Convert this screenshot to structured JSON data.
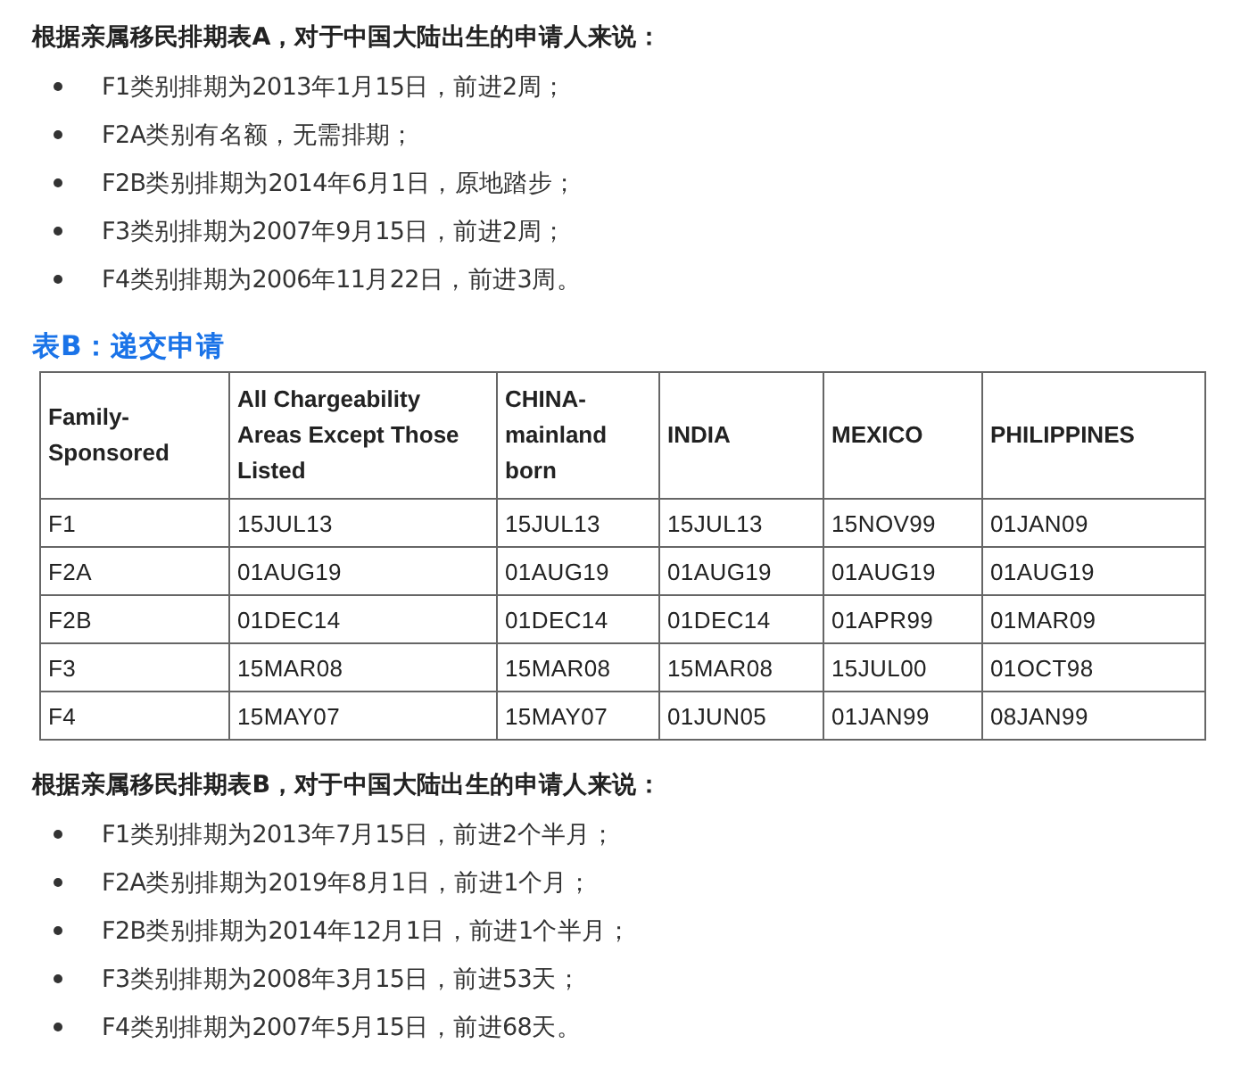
{
  "section_a": {
    "heading": "根据亲属移民排期表A，对于中国大陆出生的申请人来说：",
    "items": [
      "F1类别排期为2013年1月15日，前进2周；",
      "F2A类别有名额，无需排期；",
      "F2B类别排期为2014年6月1日，原地踏步；",
      "F3类别排期为2007年9月15日，前进2周；",
      "F4类别排期为2006年11月22日，前进3周。"
    ]
  },
  "table_b": {
    "title": "表B：递交申请",
    "columns": [
      "Family-Sponsored",
      "All Chargeability Areas Except Those Listed",
      "CHINA-mainland born",
      "INDIA",
      "MEXICO",
      "PHILIPPINES"
    ],
    "rows": [
      [
        "F1",
        "15JUL13",
        "15JUL13",
        "15JUL13",
        "15NOV99",
        "01JAN09"
      ],
      [
        "F2A",
        "01AUG19",
        "01AUG19",
        "01AUG19",
        "01AUG19",
        "01AUG19"
      ],
      [
        "F2B",
        "01DEC14",
        "01DEC14",
        "01DEC14",
        "01APR99",
        "01MAR09"
      ],
      [
        "F3",
        "15MAR08",
        "15MAR08",
        "15MAR08",
        "15JUL00",
        "01OCT98"
      ],
      [
        "F4",
        "15MAY07",
        "15MAY07",
        "01JUN05",
        "01JAN99",
        "08JAN99"
      ]
    ]
  },
  "section_b": {
    "heading": "根据亲属移民排期表B，对于中国大陆出生的申请人来说：",
    "items": [
      "F1类别排期为2013年7月15日，前进2个半月；",
      "F2A类别排期为2019年8月1日，前进1个月；",
      "F2B类别排期为2014年12月1日，前进1个半月；",
      "F3类别排期为2008年3月15日，前进53天；",
      "F4类别排期为2007年5月15日，前进68天。"
    ]
  }
}
